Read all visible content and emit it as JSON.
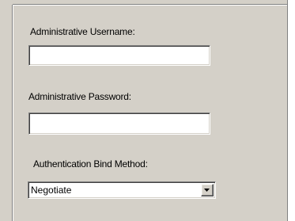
{
  "form": {
    "username_label": "Administrative Username:",
    "username_value": "",
    "password_label": "Administrative Password:",
    "password_value": "",
    "bind_method_label": "Authentication Bind Method:",
    "bind_method_selected": "Negotiate"
  },
  "icons": {
    "dropdown": "chevron-down-icon"
  },
  "colors": {
    "dialog_background": "#d4d0c8",
    "field_background": "#ffffff"
  }
}
